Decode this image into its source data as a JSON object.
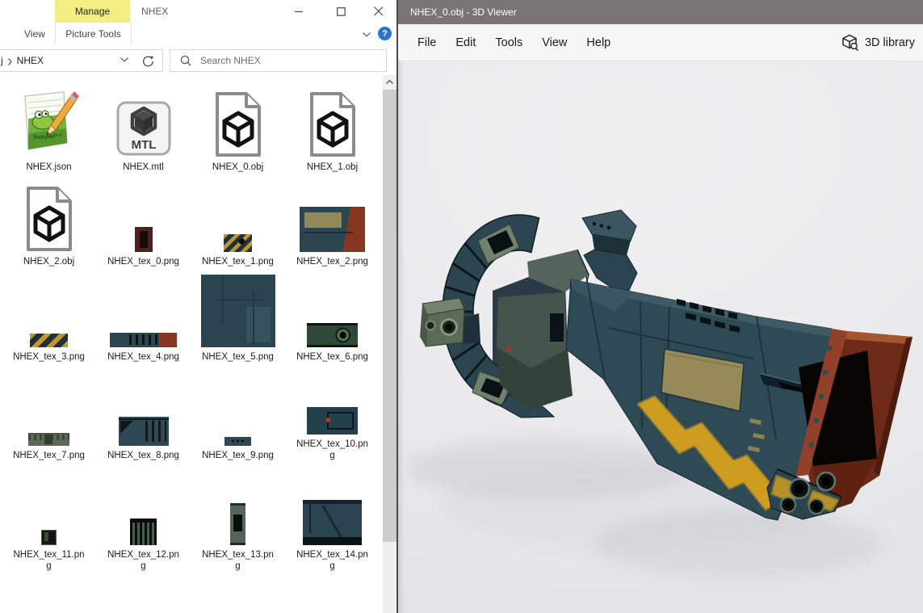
{
  "colors": {
    "tab_yellow": "#f3ef83",
    "viewer_titlebar": "#7a7475",
    "hull_teal": "#2e4a55",
    "hazard_yellow": "#dda41f",
    "rust_red": "#93402a",
    "help_blue": "#2776cc"
  },
  "explorer": {
    "window_title": "NHEX",
    "contextual_tab": "Manage",
    "ribbon_tab_view": "View",
    "ribbon_tab_picture_tools": "Picture Tools",
    "breadcrumb": {
      "clipped_fragment": "j",
      "crumb": "NHEX"
    },
    "search_placeholder": "Search NHEX",
    "files": [
      {
        "name": "NHEX.json",
        "icon": "notepadpp-icon"
      },
      {
        "name": "NHEX.mtl",
        "icon": "mtl-icon"
      },
      {
        "name": "NHEX_0.obj",
        "icon": "obj-icon"
      },
      {
        "name": "NHEX_1.obj",
        "icon": "obj-icon"
      },
      {
        "name": "NHEX_2.obj",
        "icon": "obj-icon"
      },
      {
        "name": "NHEX_tex_0.png",
        "icon": "texture-thumb",
        "variant": "t0"
      },
      {
        "name": "NHEX_tex_1.png",
        "icon": "texture-thumb",
        "variant": "t1"
      },
      {
        "name": "NHEX_tex_2.png",
        "icon": "texture-thumb",
        "variant": "t2"
      },
      {
        "name": "NHEX_tex_3.png",
        "icon": "texture-thumb",
        "variant": "t3"
      },
      {
        "name": "NHEX_tex_4.png",
        "icon": "texture-thumb",
        "variant": "t4"
      },
      {
        "name": "NHEX_tex_5.png",
        "icon": "texture-thumb",
        "variant": "t5"
      },
      {
        "name": "NHEX_tex_6.png",
        "icon": "texture-thumb",
        "variant": "t6"
      },
      {
        "name": "NHEX_tex_7.png",
        "icon": "texture-thumb",
        "variant": "t7"
      },
      {
        "name": "NHEX_tex_8.png",
        "icon": "texture-thumb",
        "variant": "t8"
      },
      {
        "name": "NHEX_tex_9.png",
        "icon": "texture-thumb",
        "variant": "t9"
      },
      {
        "name": "NHEX_tex_10.png",
        "icon": "texture-thumb",
        "variant": "t10",
        "label_lines": [
          "NHEX_tex_10.pn",
          "g"
        ]
      },
      {
        "name": "NHEX_tex_11.png",
        "icon": "texture-thumb",
        "variant": "t11",
        "label_lines": [
          "NHEX_tex_11.pn",
          "g"
        ]
      },
      {
        "name": "NHEX_tex_12.png",
        "icon": "texture-thumb",
        "variant": "t12",
        "label_lines": [
          "NHEX_tex_12.pn",
          "g"
        ]
      },
      {
        "name": "NHEX_tex_13.png",
        "icon": "texture-thumb",
        "variant": "t13",
        "label_lines": [
          "NHEX_tex_13.pn",
          "g"
        ]
      },
      {
        "name": "NHEX_tex_14.png",
        "icon": "texture-thumb",
        "variant": "t14",
        "label_lines": [
          "NHEX_tex_14.pn",
          "g"
        ]
      }
    ]
  },
  "viewer": {
    "window_title": "NHEX_0.obj - 3D Viewer",
    "menu": [
      "File",
      "Edit",
      "Tools",
      "View",
      "Help"
    ],
    "library_button": "3D library",
    "model_file": "NHEX_0.obj"
  }
}
